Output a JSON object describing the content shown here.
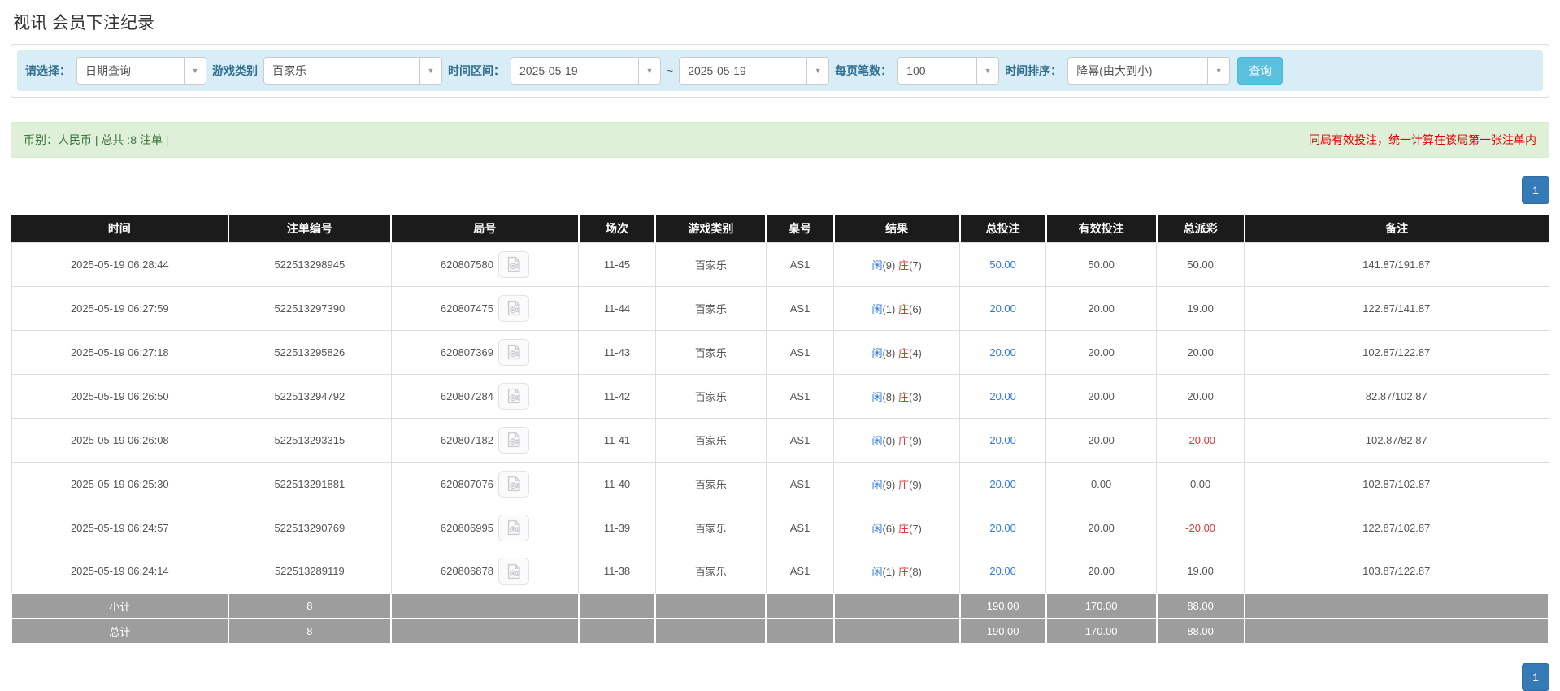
{
  "page": {
    "title": "视讯 会员下注纪录"
  },
  "filters": {
    "select_label": "请选择：",
    "select_value": "日期查询",
    "game_type_label": "游戏类别",
    "game_type_value": "百家乐",
    "time_range_label": "时间区间：",
    "date_from": "2025-05-19",
    "tilde": "~",
    "date_to": "2025-05-19",
    "page_size_label": "每页笔数：",
    "page_size_value": "100",
    "sort_label": "时间排序：",
    "sort_value": "降幂(由大到小)",
    "query_button": "查询"
  },
  "summary": {
    "left_text": "币别：人民币 | 总共 :8 注单 |",
    "right_text": "同局有效投注，统一计算在该局第一张注单内"
  },
  "pagination": {
    "page": "1"
  },
  "table": {
    "headers": {
      "time": "时间",
      "bet_no": "注单编号",
      "round_no": "局号",
      "session": "场次",
      "game": "游戏类别",
      "table_no": "桌号",
      "result": "结果",
      "total_bet": "总投注",
      "valid_bet": "有效投注",
      "payout": "总派彩",
      "remark": "备注"
    },
    "rows": [
      {
        "time": "2025-05-19 06:28:44",
        "bet_no": "522513298945",
        "round_no": "620807580",
        "session": "11-45",
        "game": "百家乐",
        "table_no": "AS1",
        "result_p_label": "闲",
        "result_p_score": "(9)",
        "result_b_label": "庄",
        "result_b_score": "(7)",
        "total_bet": "50.00",
        "valid_bet": "50.00",
        "payout": "50.00",
        "remark": "141.87/191.87"
      },
      {
        "time": "2025-05-19 06:27:59",
        "bet_no": "522513297390",
        "round_no": "620807475",
        "session": "11-44",
        "game": "百家乐",
        "table_no": "AS1",
        "result_p_label": "闲",
        "result_p_score": "(1)",
        "result_b_label": "庄",
        "result_b_score": "(6)",
        "total_bet": "20.00",
        "valid_bet": "20.00",
        "payout": "19.00",
        "remark": "122.87/141.87"
      },
      {
        "time": "2025-05-19 06:27:18",
        "bet_no": "522513295826",
        "round_no": "620807369",
        "session": "11-43",
        "game": "百家乐",
        "table_no": "AS1",
        "result_p_label": "闲",
        "result_p_score": "(8)",
        "result_b_label": "庄",
        "result_b_score": "(4)",
        "total_bet": "20.00",
        "valid_bet": "20.00",
        "payout": "20.00",
        "remark": "102.87/122.87"
      },
      {
        "time": "2025-05-19 06:26:50",
        "bet_no": "522513294792",
        "round_no": "620807284",
        "session": "11-42",
        "game": "百家乐",
        "table_no": "AS1",
        "result_p_label": "闲",
        "result_p_score": "(8)",
        "result_b_label": "庄",
        "result_b_score": "(3)",
        "total_bet": "20.00",
        "valid_bet": "20.00",
        "payout": "20.00",
        "remark": "82.87/102.87"
      },
      {
        "time": "2025-05-19 06:26:08",
        "bet_no": "522513293315",
        "round_no": "620807182",
        "session": "11-41",
        "game": "百家乐",
        "table_no": "AS1",
        "result_p_label": "闲",
        "result_p_score": "(0)",
        "result_b_label": "庄",
        "result_b_score": "(9)",
        "total_bet": "20.00",
        "valid_bet": "20.00",
        "payout": "-20.00",
        "remark": "102.87/82.87"
      },
      {
        "time": "2025-05-19 06:25:30",
        "bet_no": "522513291881",
        "round_no": "620807076",
        "session": "11-40",
        "game": "百家乐",
        "table_no": "AS1",
        "result_p_label": "闲",
        "result_p_score": "(9)",
        "result_b_label": "庄",
        "result_b_score": "(9)",
        "total_bet": "20.00",
        "valid_bet": "0.00",
        "payout": "0.00",
        "remark": "102.87/102.87"
      },
      {
        "time": "2025-05-19 06:24:57",
        "bet_no": "522513290769",
        "round_no": "620806995",
        "session": "11-39",
        "game": "百家乐",
        "table_no": "AS1",
        "result_p_label": "闲",
        "result_p_score": "(6)",
        "result_b_label": "庄",
        "result_b_score": "(7)",
        "total_bet": "20.00",
        "valid_bet": "20.00",
        "payout": "-20.00",
        "remark": "122.87/102.87"
      },
      {
        "time": "2025-05-19 06:24:14",
        "bet_no": "522513289119",
        "round_no": "620806878",
        "session": "11-38",
        "game": "百家乐",
        "table_no": "AS1",
        "result_p_label": "闲",
        "result_p_score": "(1)",
        "result_b_label": "庄",
        "result_b_score": "(8)",
        "total_bet": "20.00",
        "valid_bet": "20.00",
        "payout": "19.00",
        "remark": "103.87/122.87"
      }
    ],
    "subtotal": {
      "label": "小计",
      "count": "8",
      "total_bet": "190.00",
      "valid_bet": "170.00",
      "payout": "88.00"
    },
    "total": {
      "label": "总计",
      "count": "8",
      "total_bet": "190.00",
      "valid_bet": "170.00",
      "payout": "88.00"
    }
  },
  "colors": {
    "accent_blue": "#337ab7",
    "info_button": "#5bc0de",
    "filter_bg": "#d9edf7",
    "filter_label": "#31708f",
    "success_bg": "#dff0d8",
    "success_text": "#3c763d",
    "alert_red": "#e60000",
    "player_blue": "#2f7ae5",
    "banker_red": "#e53333",
    "link_blue": "#2f7ae5",
    "negative_red": "#e53333",
    "header_bg": "#1b1b1b",
    "sum_row_bg": "#9d9d9d"
  }
}
